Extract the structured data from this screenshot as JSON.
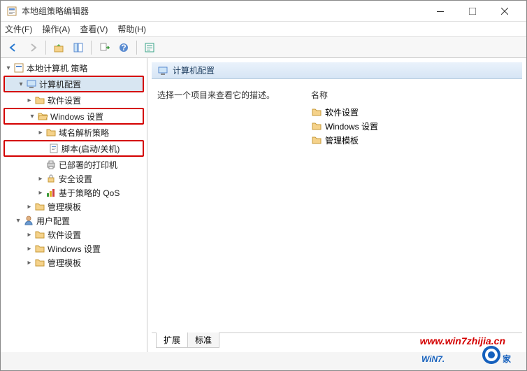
{
  "window": {
    "title": "本地组策略编辑器"
  },
  "menu": {
    "file": "文件(F)",
    "action": "操作(A)",
    "view": "查看(V)",
    "help": "帮助(H)"
  },
  "tree": {
    "root": "本地计算机 策略",
    "computer_config": "计算机配置",
    "software_settings": "软件设置",
    "windows_settings": "Windows 设置",
    "name_resolution_policy": "域名解析策略",
    "scripts": "脚本(启动/关机)",
    "deployed_printers": "已部署的打印机",
    "security_settings": "安全设置",
    "policy_qos": "基于策略的 QoS",
    "admin_templates": "管理模板",
    "user_config": "用户配置",
    "u_software_settings": "软件设置",
    "u_windows_settings": "Windows 设置",
    "u_admin_templates": "管理模板"
  },
  "right": {
    "header": "计算机配置",
    "desc": "选择一个项目来查看它的描述。",
    "col_name": "名称",
    "items": {
      "software": "软件设置",
      "windows": "Windows 设置",
      "admin": "管理模板"
    }
  },
  "tabs": {
    "extended": "扩展",
    "standard": "标准"
  },
  "watermark": {
    "url": "www.win7zhijia.cn",
    "brand1": "WiN7.",
    "brand2": "家"
  }
}
